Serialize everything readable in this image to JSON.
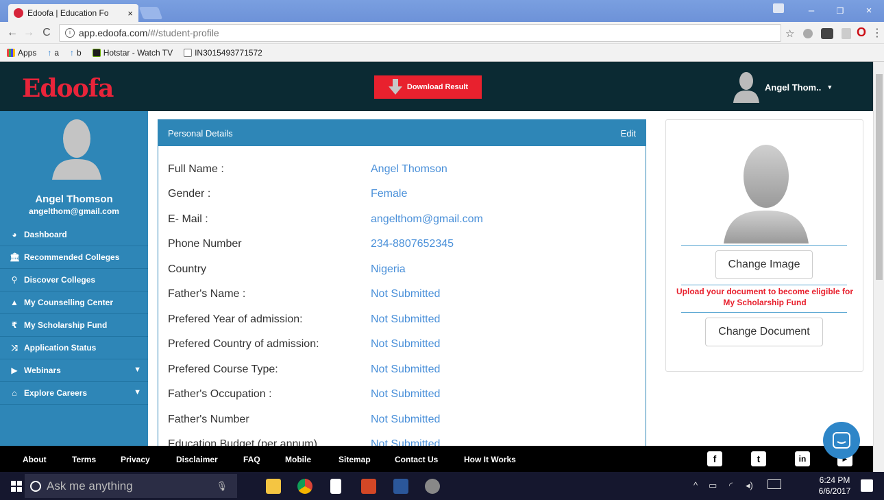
{
  "browser": {
    "tab_title": "Edoofa | Education Fo",
    "tab_close": "×",
    "url_host": "app.edoofa.com",
    "url_path": "/#/student-profile",
    "bookmarks": [
      "Apps",
      "a",
      "b",
      "Hotstar - Watch TV",
      "IN3015493771572"
    ],
    "window_controls": [
      "–",
      "❐",
      "×"
    ]
  },
  "header": {
    "logo": "Edoofa",
    "download_label": "Download Result",
    "user_label": "Angel Thom.."
  },
  "sidebar": {
    "name": "Angel Thomson",
    "email": "angelthom@gmail.com",
    "items": [
      {
        "label": "Dashboard",
        "icon": "dashboard-icon"
      },
      {
        "label": "Recommended Colleges",
        "icon": "institution-icon"
      },
      {
        "label": "Discover Colleges",
        "icon": "search-icon"
      },
      {
        "label": "My Counselling Center",
        "icon": "graduation-cap-icon"
      },
      {
        "label": "My Scholarship Fund",
        "icon": "rupee-icon"
      },
      {
        "label": "Application Status",
        "icon": "shuffle-icon"
      },
      {
        "label": "Webinars",
        "icon": "video-icon"
      },
      {
        "label": "Explore Careers",
        "icon": "home-icon"
      }
    ]
  },
  "details": {
    "title": "Personal Details",
    "edit_label": "Edit",
    "rows": [
      {
        "label": "Full Name :",
        "value": "Angel Thomson"
      },
      {
        "label": "Gender :",
        "value": "Female"
      },
      {
        "label": "E- Mail :",
        "value": "angelthom@gmail.com"
      },
      {
        "label": "Phone Number",
        "value": "234-8807652345"
      },
      {
        "label": "Country",
        "value": "Nigeria"
      },
      {
        "label": "Father's Name :",
        "value": "Not Submitted"
      },
      {
        "label": "Prefered Year of admission:",
        "value": "Not Submitted"
      },
      {
        "label": "Prefered Country of admission:",
        "value": "Not Submitted"
      },
      {
        "label": "Prefered Course Type:",
        "value": "Not Submitted"
      },
      {
        "label": "Father's Occupation :",
        "value": "Not Submitted"
      },
      {
        "label": "Father's Number",
        "value": "Not Submitted"
      },
      {
        "label": "Education Budget (per annum)",
        "value": "Not Submitted"
      }
    ]
  },
  "profile_panel": {
    "change_image": "Change Image",
    "upload_message": "Upload your document to become eligible for My Scholarship Fund",
    "change_document": "Change Document"
  },
  "footer": {
    "links": [
      "About",
      "Terms",
      "Privacy",
      "Disclaimer",
      "FAQ",
      "Mobile",
      "Sitemap",
      "Contact Us",
      "How It Works"
    ],
    "social": [
      "facebook-icon",
      "twitter-icon",
      "linkedin-icon",
      "youtube-icon"
    ]
  },
  "taskbar": {
    "search_placeholder": "Ask me anything",
    "time": "6:24 PM",
    "date": "6/6/2017"
  },
  "colors": {
    "header_bg": "#0b2a33",
    "sidebar_bg": "#2e86b7",
    "accent_red": "#e8212e",
    "value_blue": "#4a90d9"
  }
}
